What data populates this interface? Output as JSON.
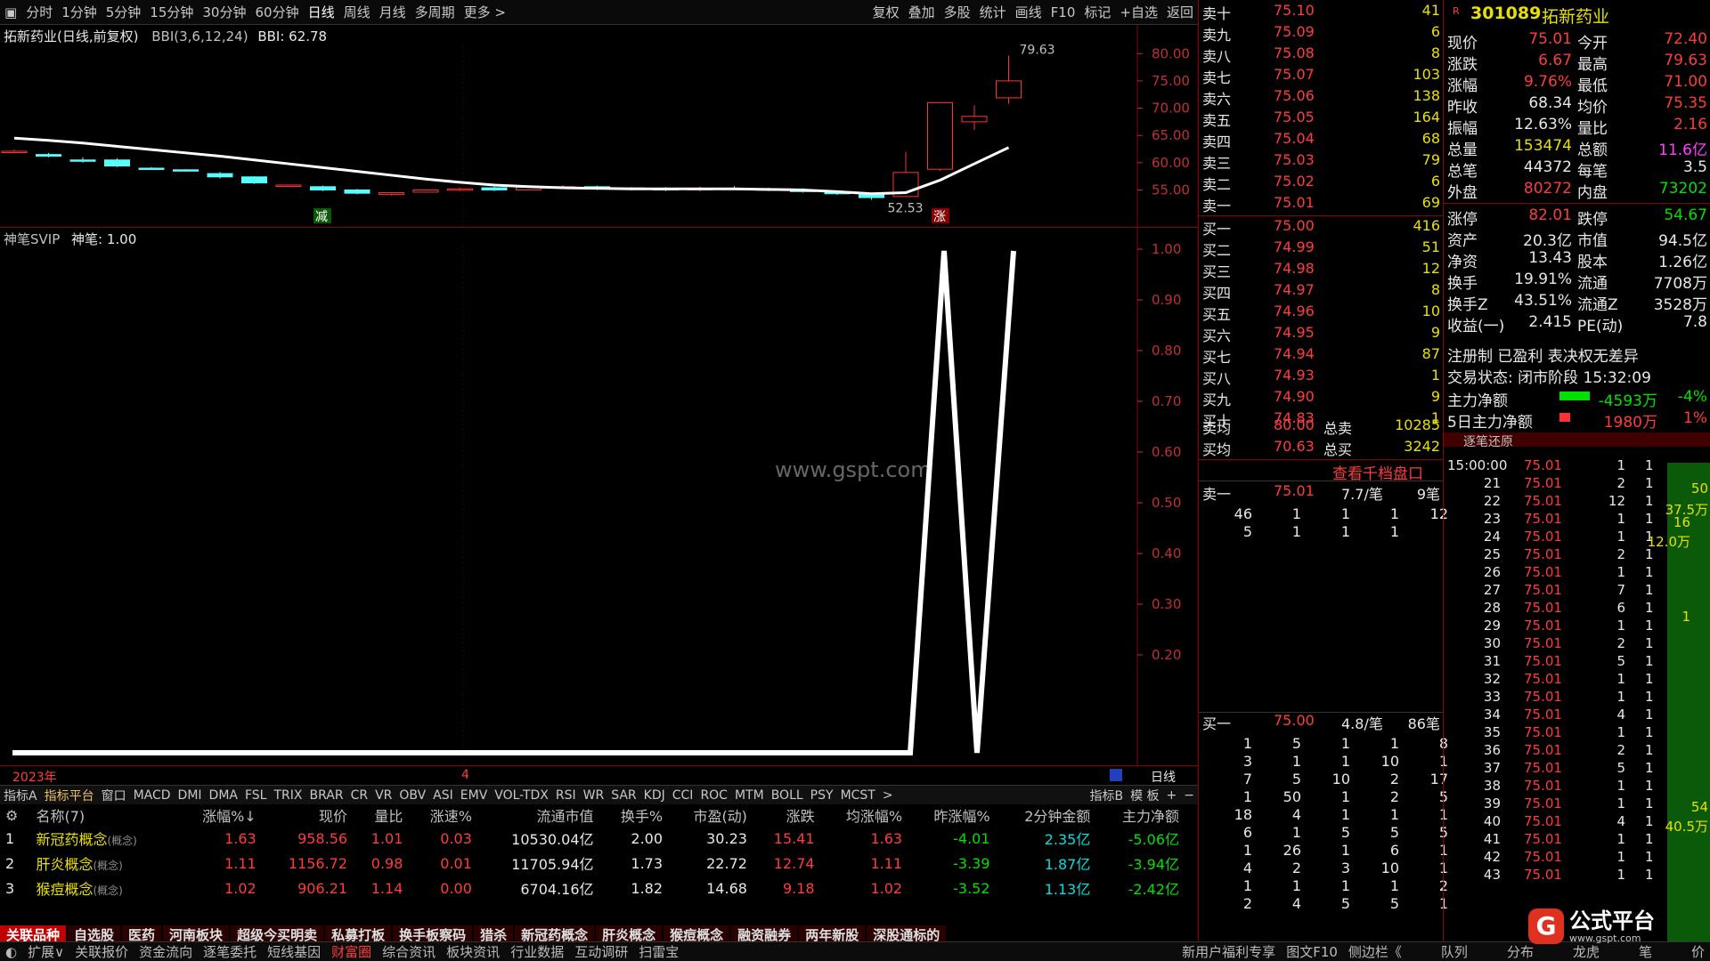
{
  "toolbar": {
    "periods": [
      "分时",
      "1分钟",
      "5分钟",
      "15分钟",
      "30分钟",
      "60分钟",
      "日线",
      "周线",
      "月线",
      "多周期",
      "更多 >"
    ],
    "active": "日线",
    "right": [
      "复权",
      "叠加",
      "多股",
      "统计",
      "画线",
      "F10",
      "标记",
      "+自选",
      "返回"
    ]
  },
  "chart_header": {
    "title": "拓新药业(日线,前复权)",
    "indicator": "BBI(3,6,12,24)",
    "value": "BBI: 62.78"
  },
  "kchart": {
    "y_ticks": [
      "80.00",
      "75.00",
      "70.00",
      "65.00",
      "60.00",
      "55.00"
    ],
    "y_range": [
      51,
      82
    ],
    "high_label": "79.63",
    "low_label": "52.53",
    "tag_down": "减",
    "tag_up": "涨",
    "candles": [
      [
        62.0,
        62.4,
        61.8,
        62.1
      ],
      [
        61.5,
        61.8,
        61.0,
        61.2
      ],
      [
        60.5,
        61.0,
        60.0,
        60.4
      ],
      [
        60.5,
        60.8,
        59.2,
        59.4
      ],
      [
        59.0,
        59.2,
        58.7,
        58.9
      ],
      [
        58.7,
        58.8,
        58.4,
        58.5
      ],
      [
        58.0,
        58.3,
        57.1,
        57.4
      ],
      [
        57.4,
        57.5,
        56.1,
        56.3
      ],
      [
        55.8,
        56.0,
        55.6,
        55.9
      ],
      [
        55.6,
        55.8,
        54.8,
        55.0
      ],
      [
        55.0,
        55.2,
        54.2,
        54.4
      ],
      [
        54.2,
        54.6,
        54.0,
        54.5
      ],
      [
        54.6,
        55.1,
        54.5,
        55.0
      ],
      [
        55.1,
        55.4,
        54.8,
        55.2
      ],
      [
        55.4,
        55.6,
        54.8,
        55.0
      ],
      [
        55.0,
        55.6,
        54.9,
        55.5
      ],
      [
        55.4,
        55.9,
        55.3,
        55.6
      ],
      [
        55.6,
        55.8,
        55.0,
        55.2
      ],
      [
        55.2,
        55.6,
        54.9,
        55.4
      ],
      [
        55.3,
        55.5,
        54.8,
        55.0
      ],
      [
        55.0,
        55.6,
        54.7,
        55.3
      ],
      [
        55.3,
        55.7,
        55.0,
        55.2
      ],
      [
        55.2,
        55.4,
        54.8,
        55.0
      ],
      [
        55.0,
        55.3,
        54.5,
        54.7
      ],
      [
        54.6,
        54.8,
        54.1,
        54.3
      ],
      [
        54.1,
        54.4,
        53.2,
        53.6
      ],
      [
        53.8,
        62.0,
        53.7,
        58.2
      ],
      [
        58.8,
        71.0,
        58.5,
        71.0
      ],
      [
        67.5,
        70.5,
        66.0,
        68.5
      ],
      [
        71.9,
        79.63,
        70.8,
        75.0
      ]
    ],
    "bbi": [
      64.5,
      64.1,
      63.6,
      63.0,
      62.4,
      61.8,
      61.2,
      60.5,
      59.8,
      59.1,
      58.4,
      57.7,
      57.0,
      56.4,
      55.9,
      55.6,
      55.4,
      55.3,
      55.2,
      55.2,
      55.2,
      55.2,
      55.1,
      55.0,
      54.7,
      54.3,
      54.5,
      56.8,
      59.8,
      62.78
    ]
  },
  "indicator": {
    "title": "神笔SVIP",
    "value": "神笔: 1.00",
    "y_ticks": [
      "1.00",
      "0.90",
      "0.80",
      "0.70",
      "0.60",
      "0.50",
      "0.40",
      "0.30",
      "0.20"
    ],
    "watermark": "www.gspt.com"
  },
  "timebar": {
    "year": "2023年",
    "month": "4",
    "period": "日线"
  },
  "tabs2": {
    "items": [
      "指标A",
      "指标平台",
      "窗口",
      "MACD",
      "DMI",
      "DMA",
      "FSL",
      "TRIX",
      "BRAR",
      "CR",
      "VR",
      "OBV",
      "ASI",
      "EMV",
      "VOL-TDX",
      "RSI",
      "WR",
      "SAR",
      "KDJ",
      "CCI",
      "ROC",
      "MTM",
      "BOLL",
      "PSY",
      "MCST",
      ">"
    ],
    "right": [
      "指标B",
      "模 板",
      "+",
      "−"
    ]
  },
  "grid": {
    "headers": [
      "名称(7)",
      "涨幅%↓",
      "现价",
      "量比",
      "涨速%",
      "流通市值",
      "换手%",
      "市盈(动)",
      "涨跌",
      "均涨幅%",
      "昨涨幅%",
      "2分钟金额",
      "主力净额"
    ],
    "rows": [
      {
        "i": "1",
        "name": "新冠药概念",
        "tag": "(概念)",
        "v": [
          "1.63",
          "958.56",
          "1.01",
          "0.03",
          "10530.04亿",
          "2.00",
          "30.23",
          "15.41",
          "1.63",
          "-4.01",
          "2.35亿",
          "-5.06亿"
        ]
      },
      {
        "i": "2",
        "name": "肝炎概念",
        "tag": "(概念)",
        "v": [
          "1.11",
          "1156.72",
          "0.98",
          "0.01",
          "11705.94亿",
          "1.73",
          "22.72",
          "12.74",
          "1.11",
          "-3.39",
          "1.87亿",
          "-3.94亿"
        ]
      },
      {
        "i": "3",
        "name": "猴痘概念",
        "tag": "(概念)",
        "v": [
          "1.02",
          "906.21",
          "1.14",
          "0.00",
          "6704.16亿",
          "1.82",
          "14.68",
          "9.18",
          "1.02",
          "-3.52",
          "1.13亿",
          "-2.42亿"
        ]
      }
    ]
  },
  "bottom_tabs": [
    "关联品种",
    "自选股",
    "医药",
    "河南板块",
    "超级今买明卖",
    "私募打板",
    "换手板察码",
    "猎杀",
    "新冠药概念",
    "肝炎概念",
    "猴痘概念",
    "融资融券",
    "两年新股",
    "深股通标的"
  ],
  "status": [
    "扩展∨",
    "关联报价",
    "资金流向",
    "逐笔委托",
    "短线基因",
    "财富圈",
    "综合资讯",
    "板块资讯",
    "行业数据",
    "互动调研",
    "扫雷宝"
  ],
  "status_right": [
    "新用户福利专享",
    "图文F10",
    "侧边栏《",
    "队列",
    "分布",
    "龙虎",
    "笔",
    "价"
  ],
  "orderbook": {
    "sell": [
      [
        "卖十",
        "75.10",
        "41"
      ],
      [
        "卖九",
        "75.09",
        "6"
      ],
      [
        "卖八",
        "75.08",
        "8"
      ],
      [
        "卖七",
        "75.07",
        "103"
      ],
      [
        "卖六",
        "75.06",
        "138"
      ],
      [
        "卖五",
        "75.05",
        "164"
      ],
      [
        "卖四",
        "75.04",
        "68"
      ],
      [
        "卖三",
        "75.03",
        "79"
      ],
      [
        "卖二",
        "75.02",
        "6"
      ],
      [
        "卖一",
        "75.01",
        "69"
      ]
    ],
    "buy": [
      [
        "买一",
        "75.00",
        "416"
      ],
      [
        "买二",
        "74.99",
        "51"
      ],
      [
        "买三",
        "74.98",
        "12"
      ],
      [
        "买四",
        "74.97",
        "8"
      ],
      [
        "买五",
        "74.96",
        "10"
      ],
      [
        "买六",
        "74.95",
        "9"
      ],
      [
        "买七",
        "74.94",
        "87"
      ],
      [
        "买八",
        "74.93",
        "1"
      ],
      [
        "买九",
        "74.90",
        "9"
      ],
      [
        "买十",
        "74.83",
        "1"
      ]
    ],
    "avg": [
      [
        "卖均",
        "80.00",
        "总卖",
        "10285"
      ],
      [
        "买均",
        "70.63",
        "总买",
        "3242"
      ]
    ],
    "link": "查看千档盘口",
    "sell1": {
      "label": "卖一",
      "price": "75.01",
      "per": "7.7/笔",
      "count": "9笔",
      "rows": [
        [
          "46",
          "1",
          "1",
          "1",
          "12"
        ],
        [
          "5",
          "1",
          "1",
          "1",
          ""
        ]
      ]
    },
    "buy1": {
      "label": "买一",
      "price": "75.00",
      "per": "4.8/笔",
      "count": "86笔",
      "rows": [
        [
          "1",
          "5",
          "1",
          "1",
          "8"
        ],
        [
          "3",
          "1",
          "1",
          "10",
          "1"
        ],
        [
          "7",
          "5",
          "10",
          "2",
          "17"
        ],
        [
          "1",
          "50",
          "1",
          "2",
          "5"
        ],
        [
          "18",
          "4",
          "1",
          "1",
          "1"
        ],
        [
          "6",
          "1",
          "5",
          "5",
          "5"
        ],
        [
          "1",
          "26",
          "1",
          "6",
          "1"
        ],
        [
          "4",
          "2",
          "3",
          "10",
          "1"
        ],
        [
          "1",
          "1",
          "1",
          "1",
          "2"
        ],
        [
          "2",
          "4",
          "5",
          "5",
          "1"
        ]
      ]
    }
  },
  "quote": {
    "code": "301089",
    "name": "拓新药业",
    "badge": "R",
    "rows": [
      [
        "现价",
        "75.01",
        "red",
        "今开",
        "72.40",
        "red"
      ],
      [
        "涨跌",
        "6.67",
        "red",
        "最高",
        "79.63",
        "red"
      ],
      [
        "涨幅",
        "9.76%",
        "red",
        "最低",
        "71.00",
        "red"
      ],
      [
        "昨收",
        "68.34",
        "wht",
        "均价",
        "75.35",
        "red"
      ],
      [
        "振幅",
        "12.63%",
        "wht",
        "量比",
        "2.16",
        "red"
      ],
      [
        "总量",
        "153474",
        "yel",
        "总额",
        "11.6亿",
        "mag"
      ],
      [
        "总笔",
        "44372",
        "wht",
        "每笔",
        "3.5",
        "wht"
      ],
      [
        "外盘",
        "80272",
        "red",
        "内盘",
        "73202",
        "grn"
      ],
      [
        "涨停",
        "82.01",
        "red",
        "跌停",
        "54.67",
        "grn"
      ],
      [
        "资产",
        "20.3亿",
        "wht",
        "市值",
        "94.5亿",
        "wht"
      ],
      [
        "净资",
        "13.43",
        "wht",
        "股本",
        "1.26亿",
        "wht"
      ],
      [
        "换手",
        "19.91%",
        "wht",
        "流通",
        "7708万",
        "wht"
      ],
      [
        "换手Z",
        "43.51%",
        "wht",
        "流通Z",
        "3528万",
        "wht"
      ],
      [
        "收益(一)",
        "2.415",
        "wht",
        "PE(动)",
        "7.8",
        "wht"
      ]
    ],
    "note": "注册制 已盈利 表决权无差异",
    "state": "交易状态: 闭市阶段 15:32:09",
    "flow1": {
      "label": "主力净额",
      "value": "-4593万",
      "pct": "-4%"
    },
    "flow2": {
      "label": "5日主力净额",
      "value": "1980万",
      "pct": "1%"
    },
    "ticks_title": "逐笔还原"
  },
  "ticks": [
    [
      "15:00:00",
      "75.01",
      "1",
      "1"
    ],
    [
      "21",
      "75.01",
      "2",
      "1"
    ],
    [
      "22",
      "75.01",
      "12",
      "1"
    ],
    [
      "23",
      "75.01",
      "1",
      "1"
    ],
    [
      "24",
      "75.01",
      "1",
      "1"
    ],
    [
      "25",
      "75.01",
      "2",
      "1"
    ],
    [
      "26",
      "75.01",
      "1",
      "1"
    ],
    [
      "27",
      "75.01",
      "7",
      "1"
    ],
    [
      "28",
      "75.01",
      "6",
      "1"
    ],
    [
      "29",
      "75.01",
      "1",
      "1"
    ],
    [
      "30",
      "75.01",
      "2",
      "1"
    ],
    [
      "31",
      "75.01",
      "5",
      "1"
    ],
    [
      "32",
      "75.01",
      "1",
      "1"
    ],
    [
      "33",
      "75.01",
      "1",
      "1"
    ],
    [
      "34",
      "75.01",
      "4",
      "1"
    ],
    [
      "35",
      "75.01",
      "1",
      "1"
    ],
    [
      "36",
      "75.01",
      "2",
      "1"
    ],
    [
      "37",
      "75.01",
      "5",
      "1"
    ],
    [
      "38",
      "75.01",
      "1",
      "1"
    ],
    [
      "39",
      "75.01",
      "1",
      "1"
    ],
    [
      "40",
      "75.01",
      "4",
      "1"
    ],
    [
      "41",
      "75.01",
      "1",
      "1"
    ],
    [
      "42",
      "75.01",
      "1",
      "1"
    ],
    [
      "43",
      "75.01",
      "1",
      "1"
    ]
  ],
  "tick_side": [
    "50",
    "37.5万",
    "16",
    "12.0万",
    "1",
    "54",
    "40.5万"
  ],
  "logo": {
    "name": "公式平台",
    "url": "www.gspt.com"
  }
}
